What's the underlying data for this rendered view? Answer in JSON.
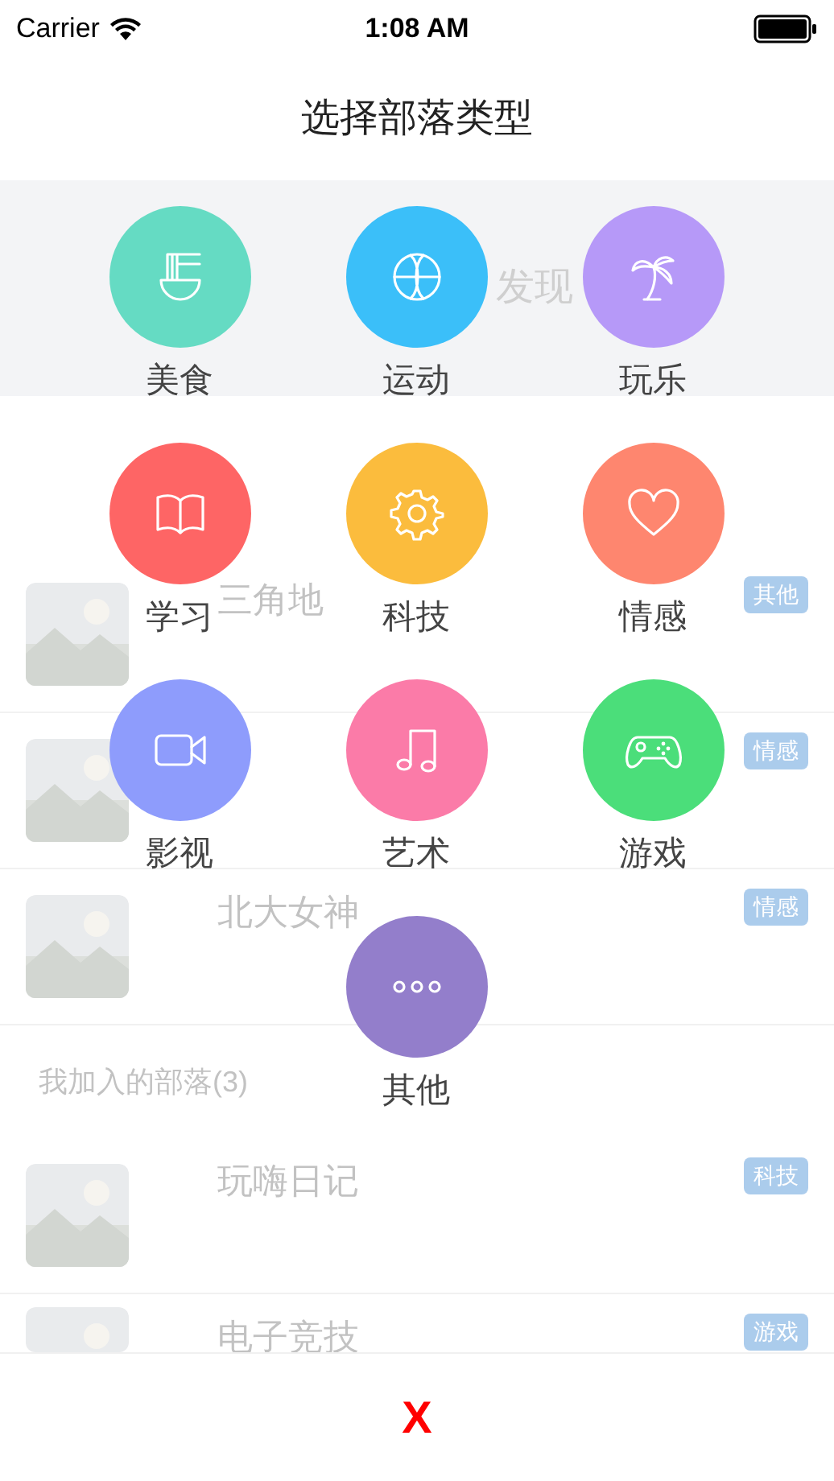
{
  "status_bar": {
    "carrier": "Carrier",
    "time": "1:08 AM"
  },
  "title": "选择部落类型",
  "background": {
    "banner_text": "发现",
    "section_header": "我加入的部落(3)",
    "rows": [
      {
        "title": "三角地",
        "tag": "其他"
      },
      {
        "tag": "情感"
      },
      {
        "title": "北大女神",
        "tag": "情感"
      },
      {
        "kind": "header"
      },
      {
        "title": "玩嗨日记",
        "tag": "科技"
      },
      {
        "title": "电子竞技",
        "tag": "游戏"
      }
    ]
  },
  "categories": [
    {
      "label": "美食",
      "color": "#65dbc3",
      "kind": "noodles"
    },
    {
      "label": "运动",
      "color": "#3bbff9",
      "kind": "ball"
    },
    {
      "label": "玩乐",
      "color": "#b699f8",
      "kind": "palm"
    },
    {
      "label": "学习",
      "color": "#fe6565",
      "kind": "book"
    },
    {
      "label": "科技",
      "color": "#fbbc3d",
      "kind": "gear"
    },
    {
      "label": "情感",
      "color": "#fe866f",
      "kind": "heart"
    },
    {
      "label": "影视",
      "color": "#8e9cfc",
      "kind": "video"
    },
    {
      "label": "艺术",
      "color": "#fb7ba8",
      "kind": "music"
    },
    {
      "label": "游戏",
      "color": "#4bde7a",
      "kind": "gamepad"
    },
    {
      "label": "其他",
      "color": "#937ecb",
      "kind": "more"
    }
  ],
  "close_label": "X"
}
